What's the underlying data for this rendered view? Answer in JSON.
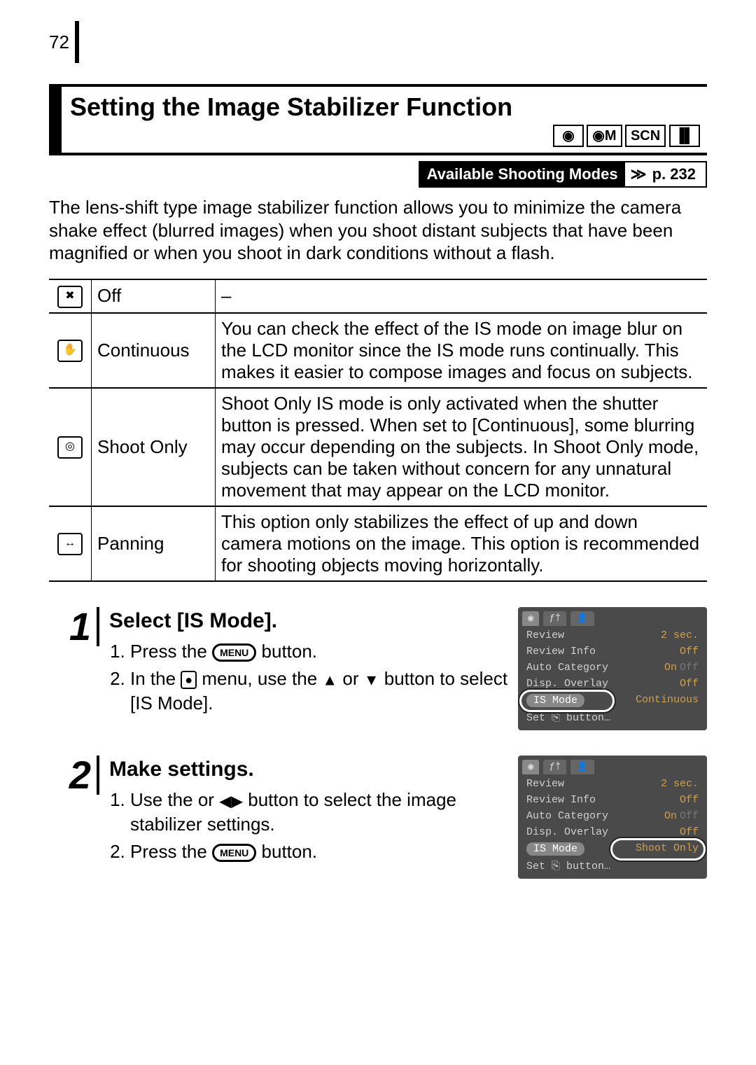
{
  "page_number": "72",
  "section_title": "Setting the Image Stabilizer Function",
  "mode_icons": [
    "◉",
    "◉M",
    "SCN",
    "▐▌"
  ],
  "available_modes": {
    "label": "Available Shooting Modes",
    "arrows": "≫",
    "page_ref": "p. 232"
  },
  "intro": "The lens-shift type image stabilizer function allows you to minimize the camera shake effect (blurred images) when you shoot distant subjects that have been magnified or when you shoot in dark conditions without a flash.",
  "is_table": [
    {
      "icon": "✖",
      "name": "Off",
      "desc": "–"
    },
    {
      "icon": "✋",
      "name": "Continuous",
      "desc": "You can check the effect of the IS mode on image blur on the LCD monitor since the IS mode runs continually. This makes it easier to compose images and focus on subjects."
    },
    {
      "icon": "◎",
      "name": "Shoot Only",
      "desc": "Shoot Only IS mode is only activated when the shutter button is pressed. When set to [Continuous], some blurring may occur depending on the subjects. In Shoot Only mode, subjects can be taken without concern for any unnatural movement that may appear on the LCD monitor."
    },
    {
      "icon": "↔",
      "name": "Panning",
      "desc": "This option only stabilizes the effect of up and down camera motions on the image. This option is recommended for shooting objects moving horizontally."
    }
  ],
  "steps": [
    {
      "num": "1",
      "title": "Select [IS Mode].",
      "items": [
        {
          "pre": "Press the ",
          "btn": "MENU",
          "post": " button."
        },
        {
          "pre": "In the ",
          "btn": "●",
          "mid": " menu, use the ",
          "arr1": "▲",
          "mid2": " or ",
          "arr2": "▼",
          "post": " button to select [IS Mode]."
        }
      ],
      "lcd": {
        "rows": [
          {
            "label": "Review",
            "value": "2 sec."
          },
          {
            "label": "Review Info",
            "value": "Off"
          },
          {
            "label": "Auto Category",
            "value": "On",
            "value_dim": "Off"
          },
          {
            "label": "Disp. Overlay",
            "value": "Off"
          },
          {
            "label": "IS Mode",
            "value": "Continuous",
            "selected_label": true,
            "oval_on_label": true
          },
          {
            "label": "Set ⎘ button…",
            "value": ""
          }
        ],
        "tabs": [
          "◉",
          "ƒ†",
          "👤"
        ]
      }
    },
    {
      "num": "2",
      "title": "Make settings.",
      "items": [
        {
          "pre": "Use the ",
          "arr1": "◀",
          "mid": " or ",
          "arr2": "▶",
          "post": " button to select the image stabilizer settings."
        },
        {
          "pre": "Press the ",
          "btn": "MENU",
          "post": " button."
        }
      ],
      "lcd": {
        "rows": [
          {
            "label": "Review",
            "value": "2 sec."
          },
          {
            "label": "Review Info",
            "value": "Off"
          },
          {
            "label": "Auto Category",
            "value": "On",
            "value_dim": "Off"
          },
          {
            "label": "Disp. Overlay",
            "value": "Off"
          },
          {
            "label": "IS Mode",
            "value": "Shoot Only",
            "selected_label": true,
            "oval_on_value": true
          },
          {
            "label": "Set ⎘ button…",
            "value": ""
          }
        ],
        "tabs": [
          "◉",
          "ƒ†",
          "👤"
        ]
      }
    }
  ]
}
